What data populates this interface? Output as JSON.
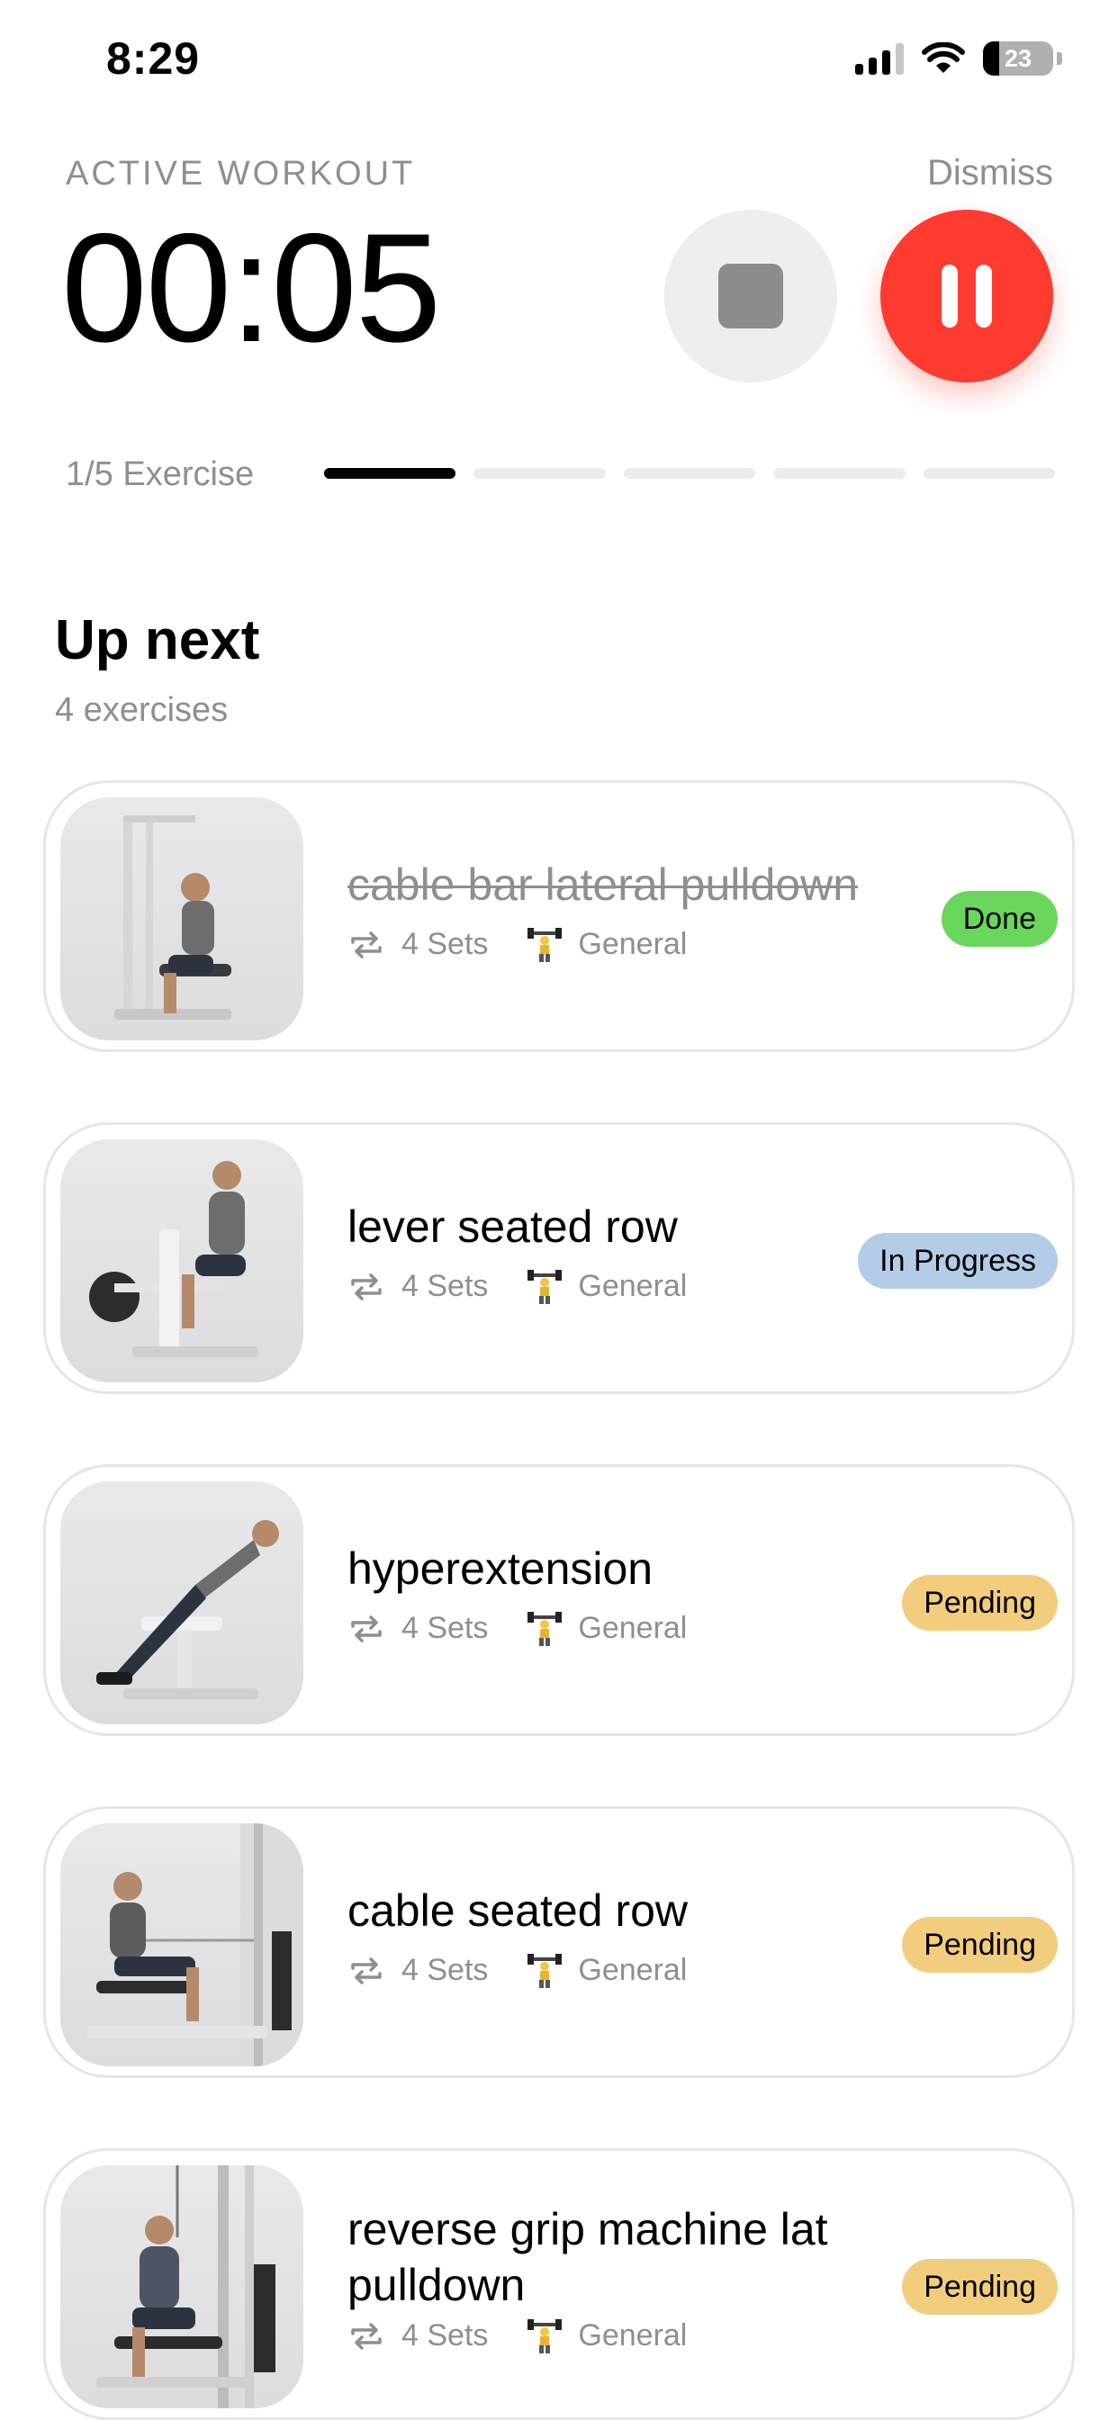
{
  "status_bar": {
    "time": "8:29",
    "battery": "23"
  },
  "header": {
    "label": "ACTIVE WORKOUT",
    "dismiss": "Dismiss",
    "timer": "00:05"
  },
  "progress": {
    "label": "1/5 Exercise",
    "current": 1,
    "total": 5
  },
  "up_next": {
    "title": "Up next",
    "count": "4 exercises"
  },
  "exercises": [
    {
      "name": "cable bar lateral pulldown",
      "sets": "4 Sets",
      "category": "General",
      "status": "Done"
    },
    {
      "name": "lever seated row",
      "sets": "4 Sets",
      "category": "General",
      "status": "In Progress"
    },
    {
      "name": "hyperextension",
      "sets": "4 Sets",
      "category": "General",
      "status": "Pending"
    },
    {
      "name": "cable seated row",
      "sets": "4 Sets",
      "category": "General",
      "status": "Pending"
    },
    {
      "name": "reverse grip machine lat pulldown",
      "sets": "4 Sets",
      "category": "General",
      "status": "Pending"
    }
  ],
  "colors": {
    "accent_red": "#ff3b30",
    "done": "#6bd65c",
    "in_progress": "#b3cde8",
    "pending": "#f2cd7d"
  },
  "icons": {
    "sets": "repeat-icon",
    "category": "weightlifter-icon",
    "stop": "stop-icon",
    "pause": "pause-icon"
  }
}
